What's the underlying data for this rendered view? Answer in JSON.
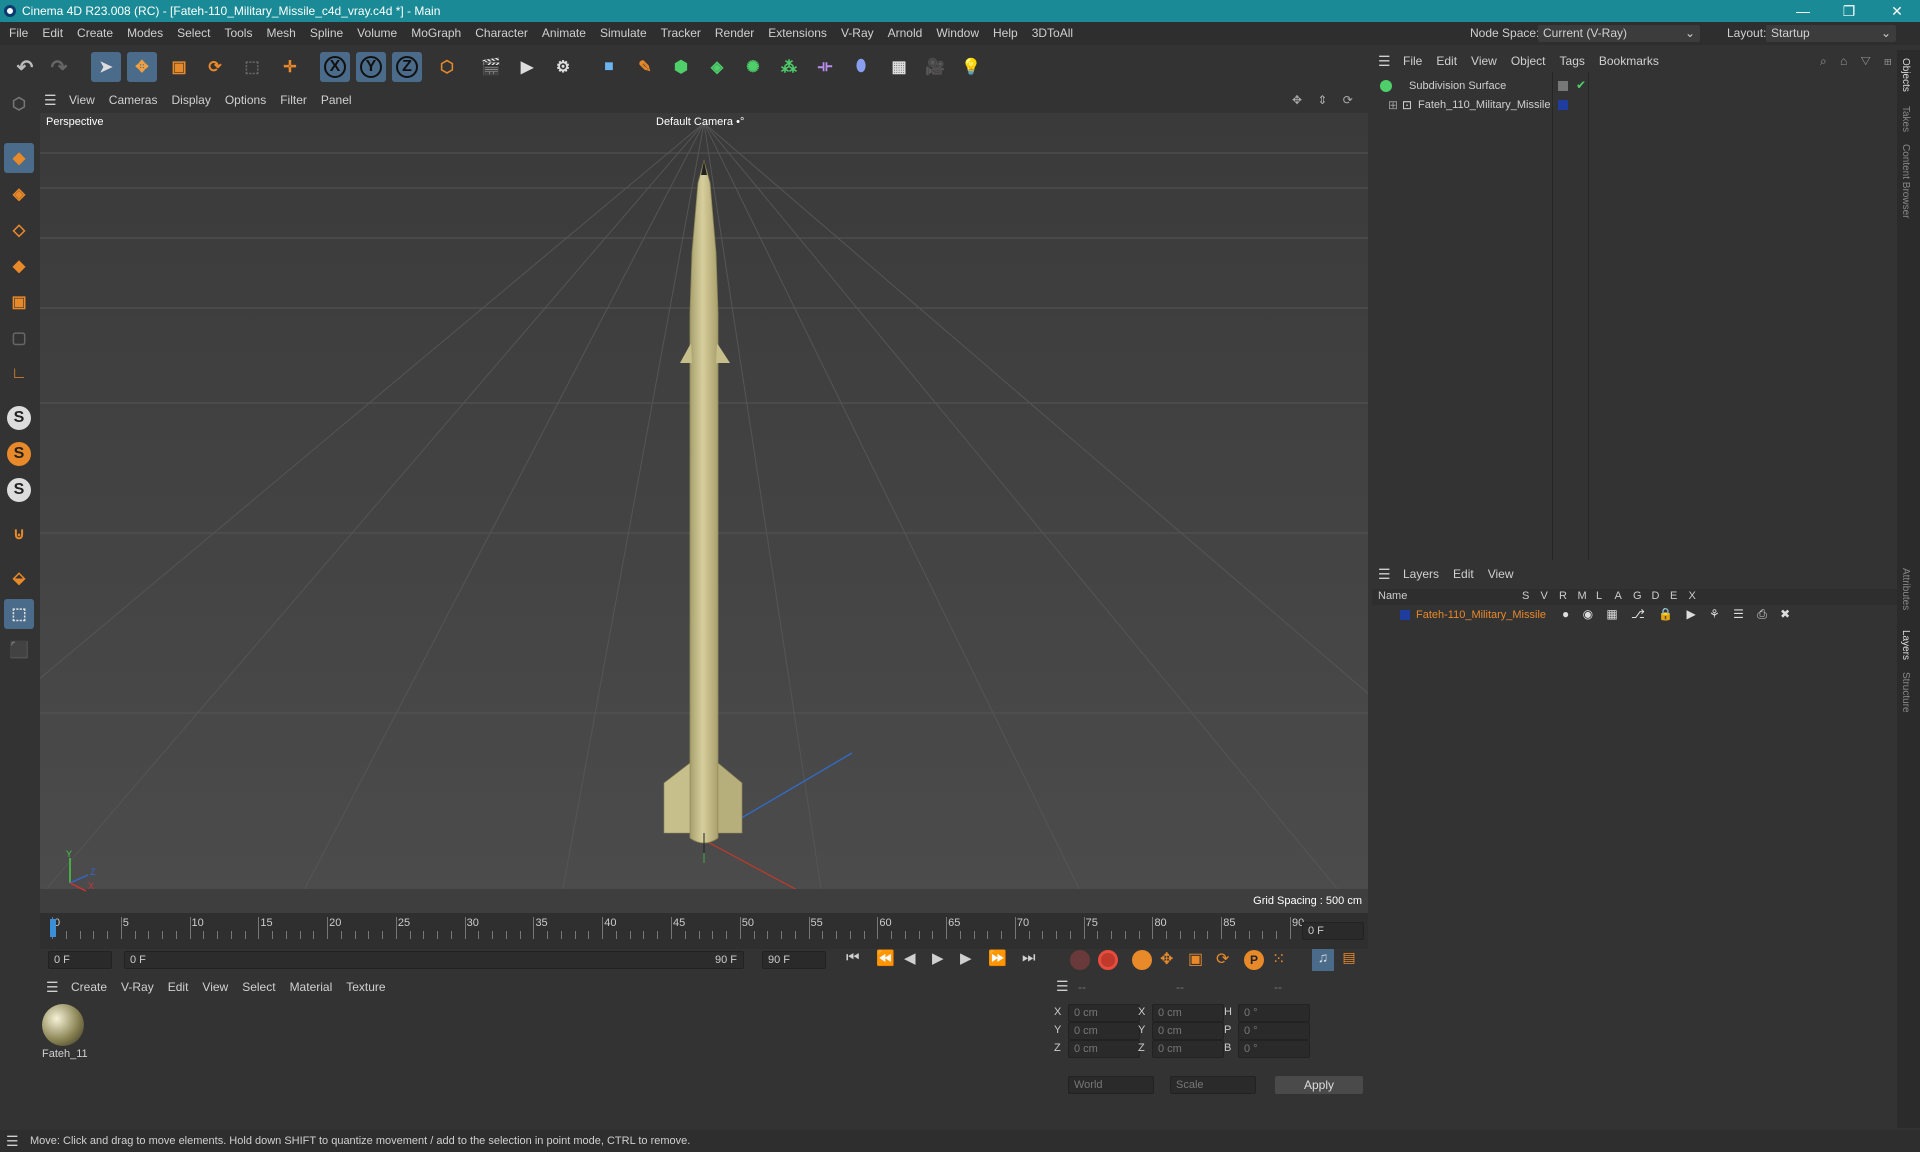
{
  "window": {
    "title": "Cinema 4D R23.008 (RC) - [Fateh-110_Military_Missile_c4d_vray.c4d *] - Main",
    "controls": [
      "—",
      "❐",
      "✕"
    ]
  },
  "menubar": {
    "items": [
      "File",
      "Edit",
      "Create",
      "Modes",
      "Select",
      "Tools",
      "Mesh",
      "Spline",
      "Volume",
      "MoGraph",
      "Character",
      "Animate",
      "Simulate",
      "Tracker",
      "Render",
      "Extensions",
      "V-Ray",
      "Arnold",
      "Window",
      "Help",
      "3DToAll"
    ],
    "node_space_label": "Node Space:",
    "node_space_value": "Current (V-Ray)",
    "layout_label": "Layout:",
    "layout_value": "Startup"
  },
  "toolbar": {
    "axis_x": "X",
    "axis_y": "Y",
    "axis_z": "Z",
    "icons": [
      "undo-icon",
      "redo-icon",
      "select-icon",
      "move-icon",
      "scale-icon",
      "rotate-icon",
      "live-select-icon",
      "add-icon",
      "x-axis-icon",
      "y-axis-icon",
      "z-axis-icon",
      "coordinate-system-icon",
      "render-region-icon",
      "render-view-icon",
      "render-settings-icon",
      "cube-icon",
      "pen-icon",
      "subdivision-icon",
      "extrude-icon",
      "cloner-icon",
      "mograph-icon",
      "deformer-icon",
      "environment-icon",
      "floor-icon",
      "camera-icon",
      "light-icon"
    ]
  },
  "left_tools": {
    "icons": [
      "model-mode-icon",
      "texture-mode-icon",
      "points-mode-icon",
      "edges-mode-icon",
      "polygons-mode-icon",
      "object-mode-icon",
      "axis-icon",
      "snap-icon",
      "snap-settings-icon",
      "snap-grid-icon",
      "magnet-icon",
      "workplane-icon",
      "grid-icon",
      "grid-snap-icon"
    ],
    "s_label": "S"
  },
  "viewport": {
    "menu": [
      "View",
      "Cameras",
      "Display",
      "Options",
      "Filter",
      "Panel"
    ],
    "view_name": "Perspective",
    "camera": "Default Camera",
    "camera_icon": "•°",
    "grid_spacing": "Grid Spacing : 500 cm",
    "axis_y": "Y",
    "axis_z": "Z",
    "axis_x": "X"
  },
  "timeline": {
    "ticks": [
      "0",
      "5",
      "10",
      "15",
      "20",
      "25",
      "30",
      "35",
      "40",
      "45",
      "50",
      "55",
      "60",
      "65",
      "70",
      "75",
      "80",
      "85",
      "90"
    ],
    "current_frame": "0 F"
  },
  "playbar": {
    "start": "0 F",
    "range_start": "0 F",
    "range_end": "90 F",
    "end": "90 F",
    "buttons": [
      "go-start-icon",
      "prev-key-icon",
      "prev-frame-icon",
      "play-icon",
      "next-frame-icon",
      "next-key-icon",
      "go-end-icon"
    ]
  },
  "material_manager": {
    "menu": [
      "Create",
      "V-Ray",
      "Edit",
      "View",
      "Select",
      "Material",
      "Texture"
    ],
    "materials": [
      {
        "name": "Fateh_11"
      }
    ]
  },
  "coordinates": {
    "headers": [
      "--",
      "--",
      "--"
    ],
    "rows": [
      {
        "a": "X",
        "av": "0 cm",
        "b": "X",
        "bv": "0 cm",
        "c": "H",
        "cv": "0 °"
      },
      {
        "a": "Y",
        "av": "0 cm",
        "b": "Y",
        "bv": "0 cm",
        "c": "P",
        "cv": "0 °"
      },
      {
        "a": "Z",
        "av": "0 cm",
        "b": "Z",
        "bv": "0 cm",
        "c": "B",
        "cv": "0 °"
      }
    ],
    "space": "World",
    "mode": "Scale",
    "apply": "Apply"
  },
  "object_manager": {
    "menu": [
      "File",
      "Edit",
      "View",
      "Object",
      "Tags",
      "Bookmarks"
    ],
    "objects": [
      {
        "name": "Subdivision Surface"
      },
      {
        "name": "Fateh_110_Military_Missile"
      }
    ]
  },
  "layer_manager": {
    "menu": [
      "Layers",
      "Edit",
      "View"
    ],
    "columns": [
      "Name",
      "S",
      "V",
      "R",
      "M",
      "L",
      "A",
      "G",
      "D",
      "E",
      "X"
    ],
    "layers": [
      {
        "name": "Fateh-110_Military_Missile",
        "color": "#1f3d9e"
      }
    ]
  },
  "right_tabs": [
    "Objects",
    "Takes",
    "Content Browser",
    "Attributes",
    "Layers",
    "Structure"
  ],
  "status": {
    "text": "Move: Click and drag to move elements. Hold down SHIFT to quantize movement / add to the selection in point mode, CTRL to remove."
  },
  "colors": {
    "accent_orange": "#e8892a",
    "accent_blue": "#3b8fd6",
    "title_teal": "#1a8b96",
    "missile": "#cfc795"
  }
}
